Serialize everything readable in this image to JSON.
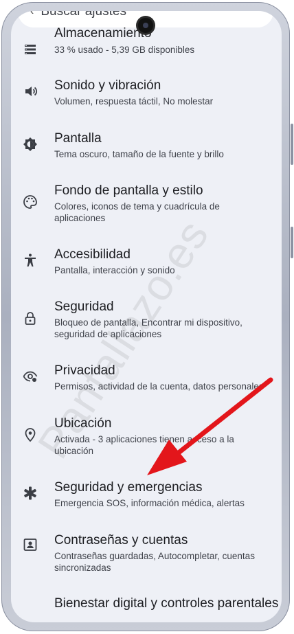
{
  "search": {
    "label": "Buscar ajustes"
  },
  "settings": {
    "items": [
      {
        "icon": "storage-icon",
        "title": "Almacenamiento",
        "subtitle": "33 % usado - 5,39 GB disponibles"
      },
      {
        "icon": "volume-icon",
        "title": "Sonido y vibración",
        "subtitle": "Volumen, respuesta táctil, No molestar"
      },
      {
        "icon": "brightness-icon",
        "title": "Pantalla",
        "subtitle": "Tema oscuro, tamaño de la fuente y brillo"
      },
      {
        "icon": "palette-icon",
        "title": "Fondo de pantalla y estilo",
        "subtitle": "Colores, iconos de tema y cuadrícula de aplicaciones"
      },
      {
        "icon": "accessibility-icon",
        "title": "Accesibilidad",
        "subtitle": "Pantalla, interacción y sonido"
      },
      {
        "icon": "lock-icon",
        "title": "Seguridad",
        "subtitle": "Bloqueo de pantalla, Encontrar mi dispositivo, seguridad de aplicaciones"
      },
      {
        "icon": "privacy-eye-icon",
        "title": "Privacidad",
        "subtitle": "Permisos, actividad de la cuenta, datos personales"
      },
      {
        "icon": "location-pin-icon",
        "title": "Ubicación",
        "subtitle": "Activada - 3 aplicaciones tienen acceso a la ubicación"
      },
      {
        "icon": "emergency-asterisk-icon",
        "title": "Seguridad y emergencias",
        "subtitle": "Emergencia SOS, información médica, alertas"
      },
      {
        "icon": "account-box-icon",
        "title": "Contraseñas y cuentas",
        "subtitle": "Contraseñas guardadas, Autocompletar, cuentas sincronizadas"
      },
      {
        "icon": "digital-wellbeing-icon",
        "title": "Bienestar digital y controles parentales",
        "subtitle": ""
      }
    ]
  },
  "watermark": "Pantallazo.es",
  "colors": {
    "arrow": "#e3161b",
    "screen_bg": "#eef0f6",
    "text": "#1c1d21"
  }
}
